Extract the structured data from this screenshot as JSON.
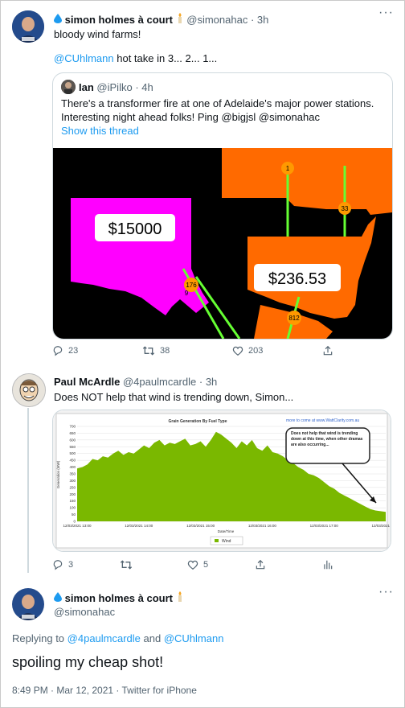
{
  "tweet1": {
    "name": "simon holmes à court",
    "handle": "@simonahac",
    "time": "3h",
    "text1": "bloody wind farms!",
    "mention": "@CUhlmann",
    "text2": " hot take in 3... 2... 1...",
    "quote": {
      "name": "Ian",
      "handle": "@iPilko",
      "time": "4h",
      "line1": "There's a transformer fire at one of Adelaide's major power stations.",
      "line2": "Interesting night ahead folks! Ping @bigjsl @simonahac",
      "show_thread": "Show this thread",
      "map": {
        "sa_price": "$15000",
        "nsw_price": "$236.53",
        "flows": [
          "1",
          "33",
          "176",
          "9",
          "812"
        ]
      }
    },
    "reply_count": "23",
    "retweet_count": "38",
    "like_count": "203"
  },
  "tweet2": {
    "name": "Paul McArdle",
    "handle": "@4paulmcardle",
    "time": "3h",
    "text": "Does NOT help that wind is trending down, Simon...",
    "reply_count": "3",
    "like_count": "5",
    "chart_data": {
      "type": "area",
      "title": "Grain Generation By Fuel Type",
      "source_text": "more to come at www.WattClarity.com.au",
      "xlabel": "Date/Time",
      "ylabel": "Generation (MW)",
      "ylim": [
        0,
        700
      ],
      "yticks": [
        "0",
        "50",
        "100",
        "150",
        "200",
        "250",
        "300",
        "350",
        "400",
        "450",
        "500",
        "550",
        "600",
        "650",
        "700"
      ],
      "xticks": [
        "12/03/2021 13:00",
        "12/03/2021 14:00",
        "12/03/2021 15:00",
        "12/03/2021 16:00",
        "12/03/2021 17:00",
        "12/03/2021 18:00"
      ],
      "x": [
        0,
        1,
        2,
        3,
        4,
        5,
        6,
        7,
        8,
        9,
        10,
        11,
        12,
        13,
        14,
        15,
        16,
        17,
        18,
        19,
        20,
        21,
        22,
        23,
        24,
        25,
        26,
        27,
        28,
        29,
        30,
        31,
        32,
        33,
        34,
        35,
        36,
        37,
        38,
        39,
        40,
        41,
        42,
        43,
        44,
        45,
        46,
        47,
        48,
        49,
        50,
        51,
        52,
        53,
        54,
        55,
        56,
        57,
        58,
        59,
        60
      ],
      "series": [
        {
          "name": "Wind",
          "color": "#7ab800",
          "values": [
            390,
            400,
            420,
            460,
            450,
            480,
            470,
            500,
            520,
            490,
            510,
            500,
            530,
            560,
            540,
            580,
            600,
            560,
            580,
            570,
            590,
            610,
            560,
            570,
            590,
            550,
            600,
            660,
            640,
            610,
            580,
            540,
            590,
            560,
            600,
            540,
            520,
            560,
            510,
            500,
            480,
            450,
            430,
            400,
            380,
            350,
            340,
            320,
            290,
            260,
            240,
            210,
            190,
            170,
            150,
            130,
            110,
            90,
            80,
            75,
            70
          ]
        }
      ],
      "annotation": "Does not help that wind is trending down at this time, when other dramas are also occurring...",
      "legend": "bottom"
    }
  },
  "tweet3": {
    "name": "simon holmes à court",
    "handle": "@simonahac",
    "replying_prefix": "Replying to ",
    "reply_to_1": "@4paulmcardle",
    "reply_and": " and ",
    "reply_to_2": "@CUhlmann",
    "text": "spoiling my cheap shot!",
    "timestamp": "8:49 PM · Mar 12, 2021 · Twitter for iPhone"
  }
}
